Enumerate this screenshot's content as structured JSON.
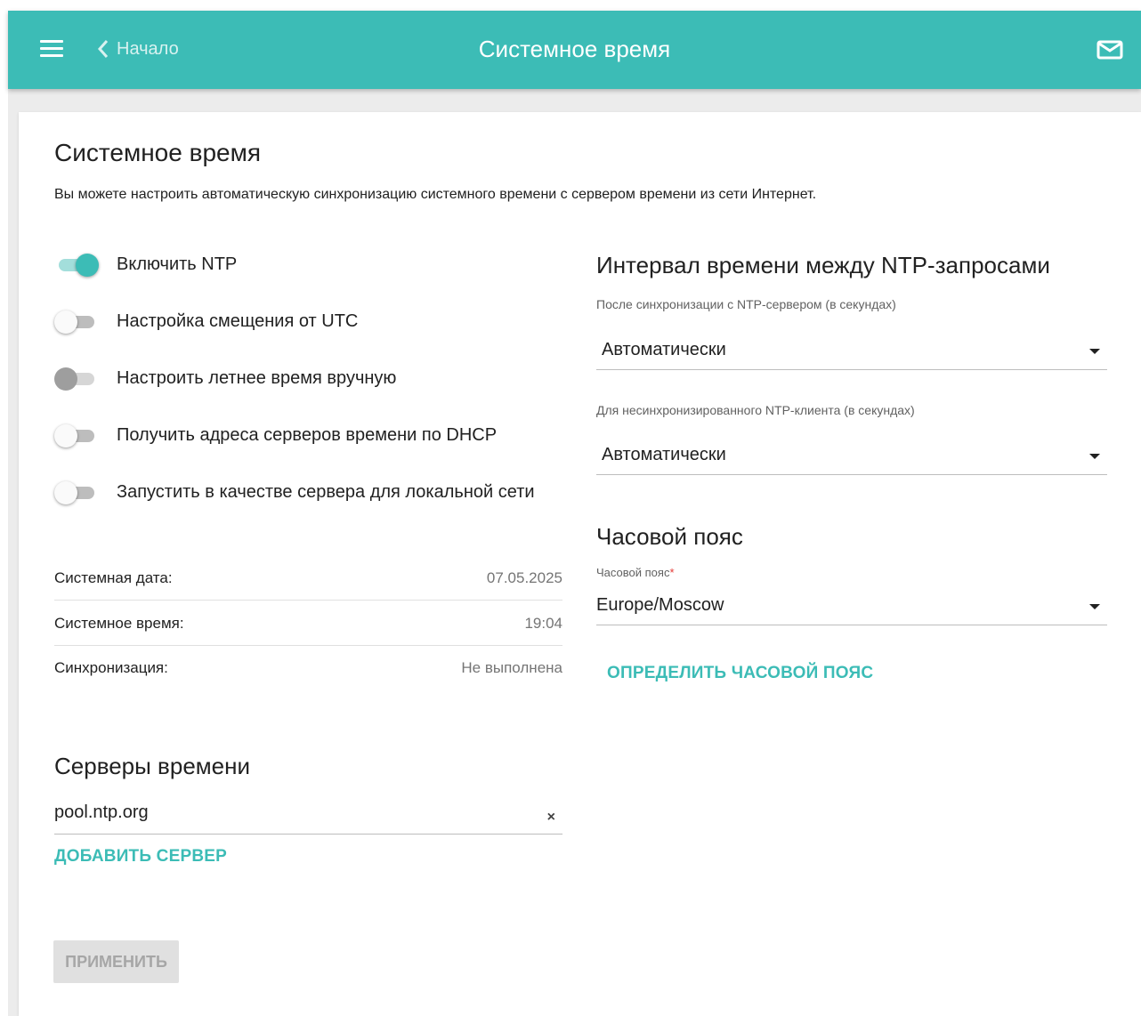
{
  "header": {
    "menu_icon": "hamburger-menu-icon",
    "back_label": "Начало",
    "title": "Системное время",
    "mail_icon": "mail-icon",
    "accent_color": "#3cbcb6"
  },
  "page": {
    "title": "Системное время",
    "description": "Вы можете настроить автоматическую синхронизацию системного времени с сервером времени из сети Интернет."
  },
  "toggles": [
    {
      "label": "Включить NTP",
      "state": "on"
    },
    {
      "label": "Настройка смещения от UTC",
      "state": "off"
    },
    {
      "label": "Настроить летнее время вручную",
      "state": "disabled"
    },
    {
      "label": "Получить адреса серверов времени по DHCP",
      "state": "off"
    },
    {
      "label": "Запустить в качестве сервера для локальной сети",
      "state": "off"
    }
  ],
  "info": [
    {
      "label": "Системная дата:",
      "value": "07.05.2025"
    },
    {
      "label": "Системное время:",
      "value": "19:04"
    },
    {
      "label": "Синхронизация:",
      "value": "Не выполнена"
    }
  ],
  "servers": {
    "title": "Серверы времени",
    "items": [
      "pool.ntp.org"
    ],
    "clear_symbol": "×",
    "add_label": "ДОБАВИТЬ СЕРВЕР"
  },
  "apply_label": "ПРИМЕНИТЬ",
  "interval": {
    "title": "Интервал времени между NTP-запросами",
    "after_sync_label": "После синхронизации с NTP-сервером (в секундах)",
    "after_sync_value": "Автоматически",
    "unsync_label": "Для несинхронизированного NTP-клиента (в секундах)",
    "unsync_value": "Автоматически"
  },
  "timezone": {
    "title": "Часовой пояс",
    "field_label": "Часовой пояс",
    "required_mark": "*",
    "value": "Europe/Moscow",
    "detect_label": "ОПРЕДЕЛИТЬ ЧАСОВОЙ ПОЯС"
  }
}
